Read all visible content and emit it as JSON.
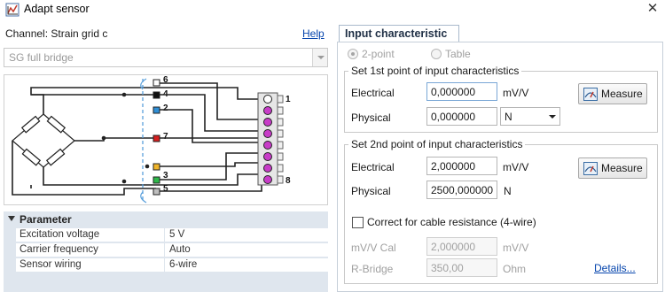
{
  "window": {
    "title": "Adapt sensor",
    "close_glyph": "✕"
  },
  "left": {
    "channel_label": "Channel: Strain grid c",
    "help_link": "Help",
    "sensor_combo": {
      "value": "SG full bridge"
    },
    "diagram": {
      "wire_numbers": [
        "6",
        "4",
        "2",
        "7",
        "3",
        "5"
      ],
      "wire_colors": [
        "#ffffff",
        "#111111",
        "#2f8fd6",
        "#d61f1f",
        "#f0b429",
        "#2fb84a",
        "#bfbfbf"
      ],
      "connector_pins": [
        "1",
        "8"
      ]
    },
    "parameter": {
      "title": "Parameter",
      "rows": [
        {
          "name": "Excitation voltage",
          "value": "5 V"
        },
        {
          "name": "Carrier frequency",
          "value": "Auto"
        },
        {
          "name": "Sensor wiring",
          "value": "6-wire"
        }
      ]
    }
  },
  "right": {
    "tab_label": "Input characteristic",
    "mode": {
      "option_2point": "2-point",
      "option_table": "Table",
      "selected": "2-point"
    },
    "point1": {
      "title": "Set 1st point of input characteristics",
      "electrical_label": "Electrical",
      "electrical_value": "0,000000",
      "electrical_unit": "mV/V",
      "physical_label": "Physical",
      "physical_value": "0,000000",
      "physical_unit": "N",
      "measure_label": "Measure"
    },
    "point2": {
      "title": "Set 2nd point of input characteristics",
      "electrical_label": "Electrical",
      "electrical_value": "2,000000",
      "electrical_unit": "mV/V",
      "physical_label": "Physical",
      "physical_value": "2500,000000",
      "physical_unit": "N",
      "measure_label": "Measure",
      "cable_check_label": "Correct for cable resistance (4-wire)",
      "cable_checked": false,
      "mvv_cal_label": "mV/V Cal",
      "mvv_cal_value": "2,000000",
      "mvv_cal_unit": "mV/V",
      "rbridge_label": "R-Bridge",
      "rbridge_value": "350,00",
      "rbridge_unit": "Ohm",
      "details_link": "Details..."
    }
  },
  "icons": {
    "app": "adapt-sensor-icon",
    "measure": "measure-gauge-icon"
  }
}
